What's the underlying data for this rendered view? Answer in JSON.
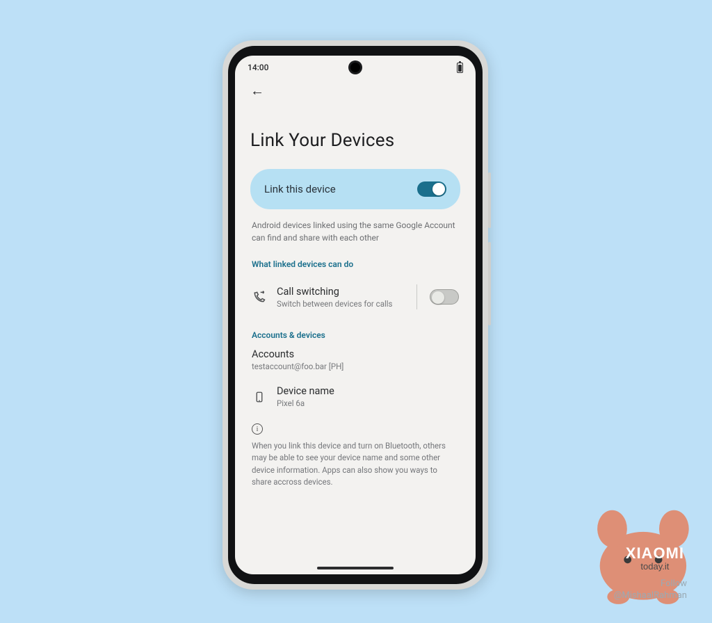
{
  "statusbar": {
    "time": "14:00"
  },
  "nav": {
    "back_icon": "←"
  },
  "page": {
    "title": "Link Your Devices",
    "link_card": {
      "label": "Link this device",
      "enabled": true
    },
    "link_desc": "Android devices linked using the same Google Account can find and share with each other",
    "section_what": "What linked devices can do",
    "call_switching": {
      "title": "Call switching",
      "subtitle": "Switch between devices for calls",
      "enabled": false
    },
    "section_accounts": "Accounts & devices",
    "accounts": {
      "title": "Accounts",
      "value": "testaccount@foo.bar [PH]"
    },
    "device": {
      "title": "Device name",
      "value": "Pixel 6a"
    },
    "info_text": "When you link this device and turn on Bluetooth, others may be able to see your device name and some other device information. Apps can also show you ways to share accross devices."
  },
  "watermark": {
    "brand_top": "XIAOMI",
    "brand_bottom": "today.it",
    "follow": "Follow",
    "handle": "@MishaalRahman"
  },
  "colors": {
    "bg": "#bde0f7",
    "accent": "#1a6f8c",
    "pill": "#b6e0f3",
    "mascot": "#de8f76"
  }
}
